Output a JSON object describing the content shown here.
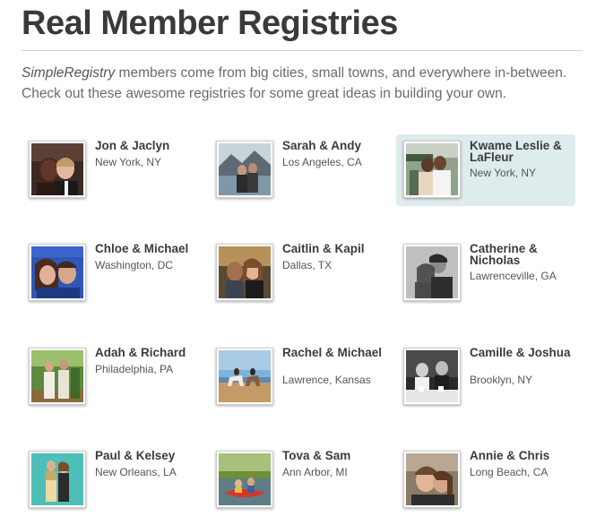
{
  "page": {
    "title": "Real Member Registries",
    "intro_brand": "SimpleRegistry",
    "intro_rest": " members come from big cities, small towns, and everywhere in-between. Check out these awesome registries for some great ideas in building your own."
  },
  "registries": [
    {
      "names": "Jon & Jaclyn",
      "location": "New York, NY",
      "photo": "couple-selfie-dark"
    },
    {
      "names": "Sarah & Andy",
      "location": "Los Angeles, CA",
      "photo": "couple-lake-mountains"
    },
    {
      "names": "Kwame Leslie & LaFleur",
      "location": "New York, NY",
      "photo": "couple-garden-white"
    },
    {
      "names": "Chloe & Michael",
      "location": "Washington, DC",
      "photo": "couple-blue-backdrop"
    },
    {
      "names": "Caitlin & Kapil",
      "location": "Dallas, TX",
      "photo": "couple-selfie-evening"
    },
    {
      "names": "Catherine & Nicholas",
      "location": "Lawrenceville, GA",
      "photo": "couple-black-white"
    },
    {
      "names": "Adah & Richard",
      "location": "Philadelphia, PA",
      "photo": "couple-outdoors-trees"
    },
    {
      "names": "Rachel & Michael",
      "location": "Lawrence, Kansas",
      "photo": "couple-horses-beach"
    },
    {
      "names": "Camille & Joshua",
      "location": "Brooklyn, NY",
      "photo": "couple-table-bw"
    },
    {
      "names": "Paul & Kelsey",
      "location": "New Orleans, LA",
      "photo": "couple-teal-wall"
    },
    {
      "names": "Tova & Sam",
      "location": "Ann Arbor, MI",
      "photo": "couple-kayak-river"
    },
    {
      "names": "Annie & Chris",
      "location": "Long Beach, CA",
      "photo": "couple-selfie-close"
    }
  ],
  "colors": {
    "highlight": "#dfeced",
    "title": "#3a3a3a",
    "divider": "#c9d9db"
  }
}
